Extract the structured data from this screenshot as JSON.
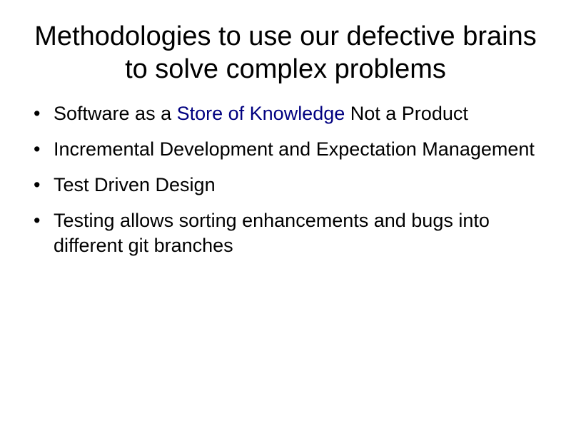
{
  "slide": {
    "title": "Methodologies to use our defective brains to solve complex problems",
    "bullet_symbol": "•",
    "bullets": [
      {
        "before": "Software as a ",
        "highlight": "Store of Knowledge",
        "after": " Not a Product"
      },
      {
        "text": "Incremental Development and Expectation Management"
      },
      {
        "text": "Test Driven Design"
      },
      {
        "text": "Testing allows sorting enhancements and bugs into different git branches"
      }
    ],
    "colors": {
      "text": "#000000",
      "highlight": "#000080",
      "background": "#ffffff"
    }
  }
}
